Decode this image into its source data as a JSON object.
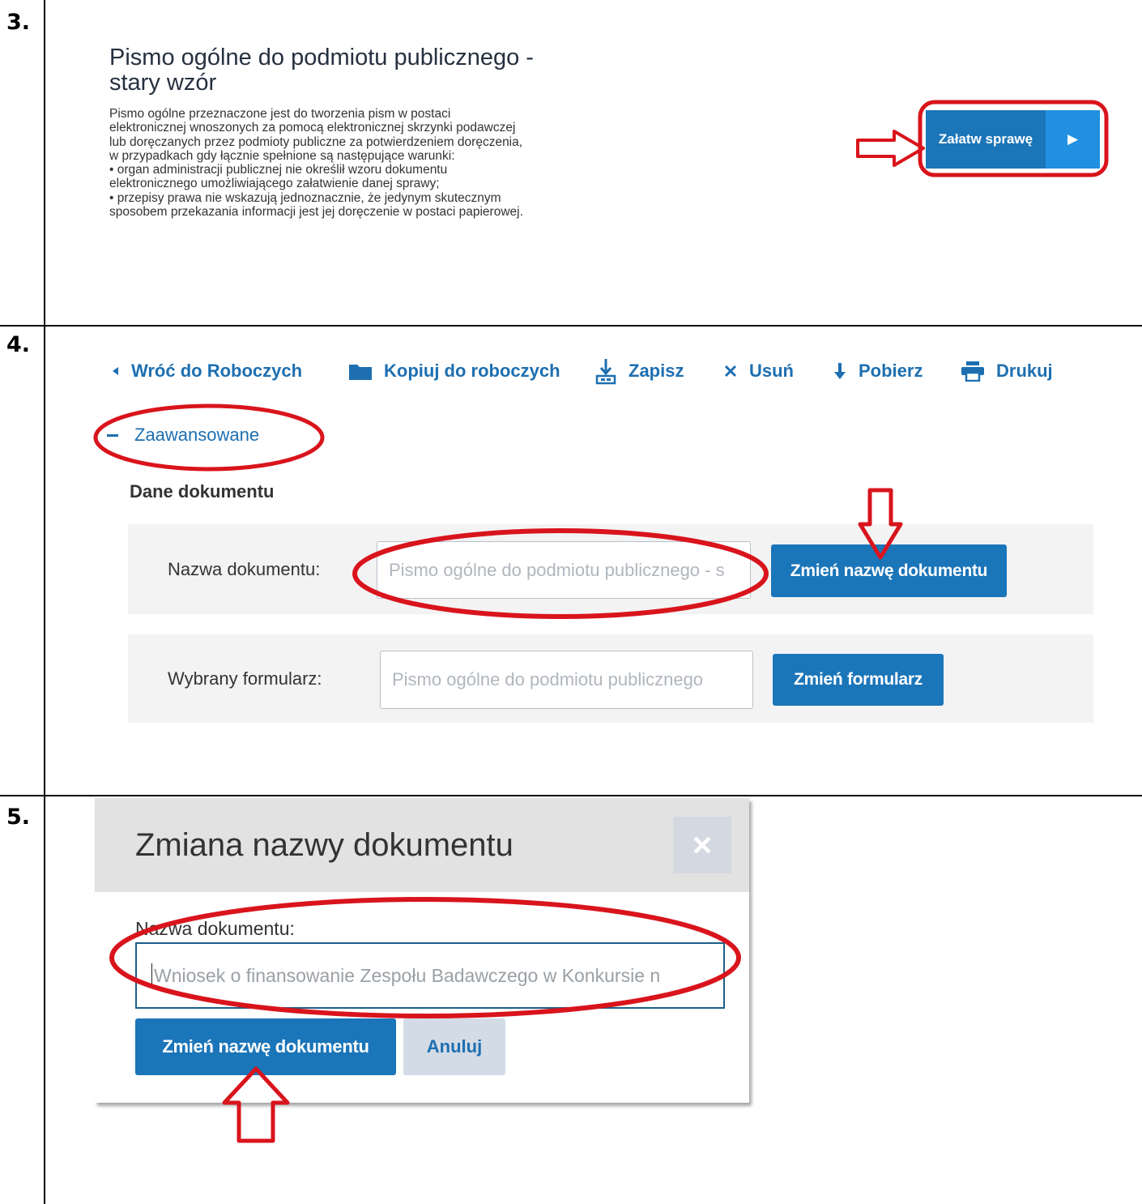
{
  "steps": [
    "3.",
    "4.",
    "5."
  ],
  "step3": {
    "title_line1": "Pismo ogólne do podmiotu publicznego -",
    "title_line2": "stary wzór",
    "description_lines": [
      "Pismo ogólne przeznaczone jest do tworzenia pism w postaci",
      "elektronicznej wnoszonych za pomocą elektronicznej skrzynki podawczej",
      "lub doręczanych przez podmioty publiczne za potwierdzeniem doręczenia,",
      "w przypadkach gdy łącznie spełnione są następujące warunki:",
      "• organ administracji publicznej nie określił wzoru dokumentu",
      "elektronicznego umożliwiającego załatwienie danej sprawy;",
      "• przepisy prawa nie wskazują jednoznacznie, że jedynym skutecznym",
      "sposobem przekazania informacji jest jej doręczenie w postaci papierowej."
    ],
    "button_label": "Załatw sprawę",
    "button_arrow": "▶"
  },
  "step4": {
    "toolbar": {
      "back": "Wróć do Roboczych",
      "copy": "Kopiuj do roboczych",
      "save": "Zapisz",
      "delete": "Usuń",
      "download": "Pobierz",
      "print": "Drukuj"
    },
    "advanced_toggle": "Zaawansowane",
    "section_title": "Dane dokumentu",
    "name_label": "Nazwa dokumentu:",
    "name_value": "Pismo ogólne do podmiotu publicznego - s",
    "rename_button": "Zmień nazwę dokumentu",
    "form_label": "Wybrany formularz:",
    "form_value": "Pismo ogólne do podmiotu publicznego",
    "change_form_button": "Zmień formularz"
  },
  "step5": {
    "modal_title": "Zmiana nazwy dokumentu",
    "close": "×",
    "field_label": "Nazwa dokumentu:",
    "field_value": "Wniosek o finansowanie Zespołu Badawczego w Konkursie n",
    "confirm_button": "Zmień nazwę dokumentu",
    "cancel_button": "Anuluj"
  },
  "colors": {
    "primary_blue": "#1b75b9",
    "link_blue": "#1d6fb1",
    "annotation_red": "#d9141c"
  }
}
